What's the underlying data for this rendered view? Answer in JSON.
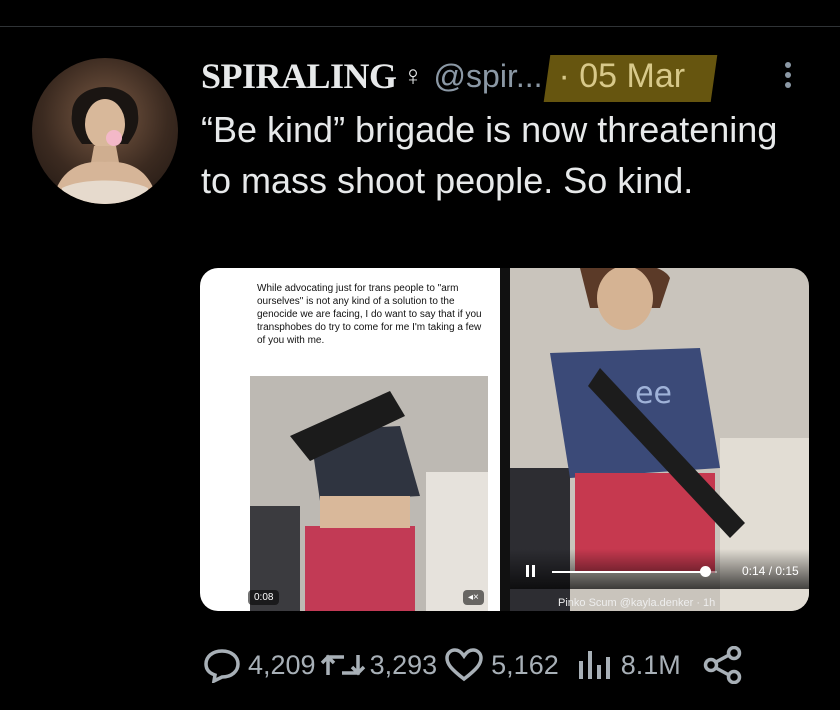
{
  "user": {
    "display_name": "SPIRALING",
    "gender_symbol": "♀",
    "handle": "@spir...",
    "date": "· 05 Mar"
  },
  "icons": {
    "more": "more-vertical-icon",
    "reply": "reply-icon",
    "retweet": "retweet-icon",
    "like": "heart-icon",
    "views": "views-chart-icon",
    "share": "share-icon"
  },
  "tweet": {
    "text": "“Be kind” brigade is now threatening to mass shoot people. So kind."
  },
  "media": {
    "left": {
      "quote_text": "While advocating just for trans people to \"arm ourselves\" is not any kind of a solution to the genocide we are facing, I do want to say that if you transphobes do try to come for me I'm taking a few of you with me.",
      "duration": "0:08"
    },
    "right": {
      "progress": 0.93,
      "time": "0:14 / 0:15",
      "byline": "Pinko Scum @kayla.denker · 1h"
    }
  },
  "stats": {
    "replies": "4,209",
    "retweets": "3,293",
    "likes": "5,162",
    "views": "8.1M"
  },
  "colors": {
    "background": "#000000",
    "text": "#e7e9ea",
    "muted": "#8b98a5",
    "date_highlight": "#6b5a10"
  }
}
